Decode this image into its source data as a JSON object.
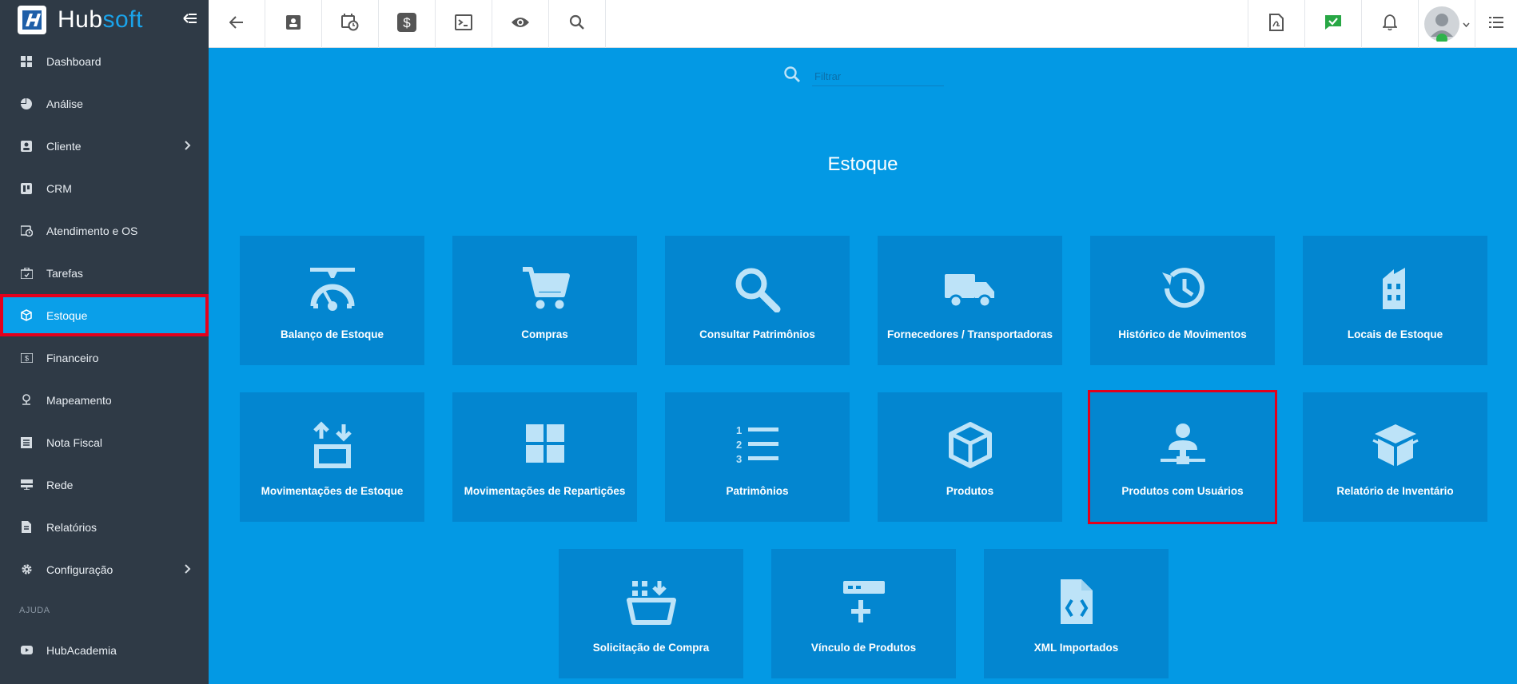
{
  "brand": {
    "name_part1": "Hub",
    "name_part2": "soft"
  },
  "sidebar": {
    "items": [
      {
        "label": "Dashboard",
        "icon": "dashboard-icon"
      },
      {
        "label": "Análise",
        "icon": "pie-chart-icon"
      },
      {
        "label": "Cliente",
        "icon": "contact-icon",
        "has_submenu": true
      },
      {
        "label": "CRM",
        "icon": "trello-board-icon"
      },
      {
        "label": "Atendimento e OS",
        "icon": "calendar-clock-icon"
      },
      {
        "label": "Tarefas",
        "icon": "briefcase-icon"
      },
      {
        "label": "Estoque",
        "icon": "box-icon",
        "active": true
      },
      {
        "label": "Financeiro",
        "icon": "money-icon"
      },
      {
        "label": "Mapeamento",
        "icon": "map-pin-icon"
      },
      {
        "label": "Nota Fiscal",
        "icon": "receipt-icon"
      },
      {
        "label": "Rede",
        "icon": "server-icon"
      },
      {
        "label": "Relatórios",
        "icon": "report-icon"
      },
      {
        "label": "Configuração",
        "icon": "gear-icon",
        "has_submenu": true
      }
    ],
    "section_label": "AJUDA",
    "help_items": [
      {
        "label": "HubAcademia",
        "icon": "youtube-icon"
      }
    ]
  },
  "topbar": {
    "left_buttons": [
      "back-arrow-icon",
      "contact-card-icon",
      "calendar-clock-icon",
      "dollar-icon",
      "terminal-icon",
      "eye-icon",
      "search-icon"
    ],
    "right_buttons": [
      "pdf-icon",
      "check-message-icon",
      "bell-icon",
      "avatar",
      "list-icon"
    ]
  },
  "filter": {
    "placeholder": "Filtrar"
  },
  "page": {
    "title": "Estoque"
  },
  "tiles": [
    {
      "label": "Balanço de Estoque",
      "icon": "scale-icon"
    },
    {
      "label": "Compras",
      "icon": "shopping-cart-icon"
    },
    {
      "label": "Consultar Patrimônios",
      "icon": "magnifier-icon"
    },
    {
      "label": "Fornecedores / Transportadoras",
      "icon": "truck-icon"
    },
    {
      "label": "Histórico de Movimentos",
      "icon": "history-icon"
    },
    {
      "label": "Locais de Estoque",
      "icon": "building-icon"
    },
    {
      "label": "Movimentações de Estoque",
      "icon": "box-arrows-icon"
    },
    {
      "label": "Movimentações de Repartições",
      "icon": "grid-windows-icon"
    },
    {
      "label": "Patrimônios",
      "icon": "numbered-list-icon"
    },
    {
      "label": "Produtos",
      "icon": "package-icon"
    },
    {
      "label": "Produtos com Usuários",
      "icon": "user-network-icon",
      "highlighted": true
    },
    {
      "label": "Relatório de Inventário",
      "icon": "open-box-icon"
    },
    {
      "label": "Solicitação de Compra",
      "icon": "basket-download-icon"
    },
    {
      "label": "Vínculo de Produtos",
      "icon": "link-plus-icon"
    },
    {
      "label": "XML Importados",
      "icon": "code-file-icon"
    }
  ],
  "colors": {
    "sidebar_bg": "#2f3a46",
    "main_bg": "#0399e4",
    "tile_bg": "#0386d0",
    "active_item": "#0a9fe9",
    "highlight": "#e3001b",
    "icon_light": "#bde3f8"
  }
}
